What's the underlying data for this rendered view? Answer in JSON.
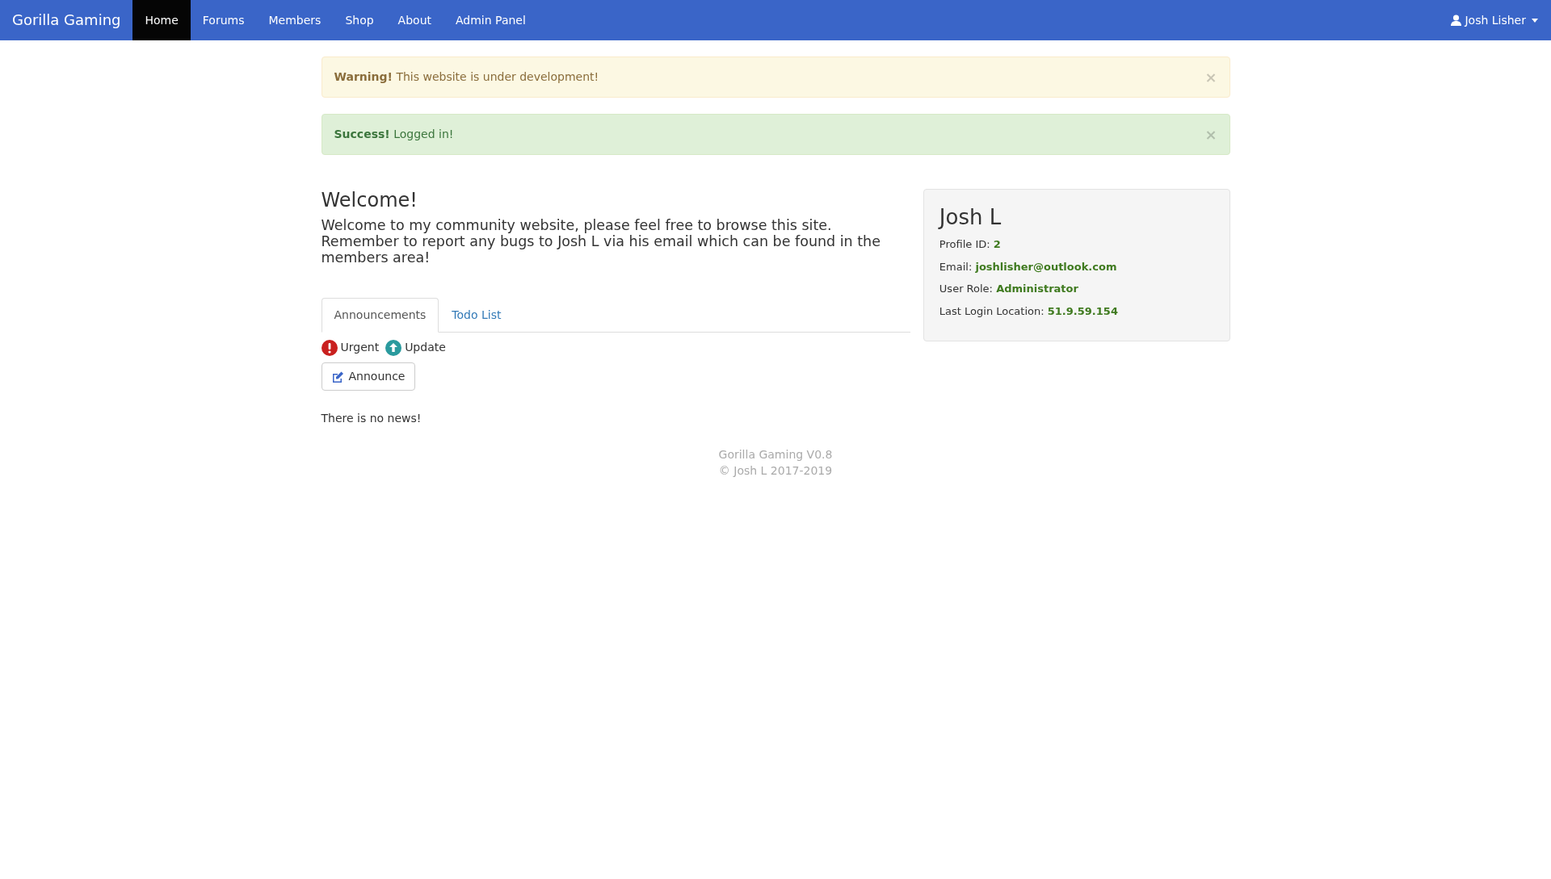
{
  "navbar": {
    "brand": "Gorilla Gaming",
    "items": [
      {
        "label": "Home",
        "selected": true
      },
      {
        "label": "Forums",
        "selected": false
      },
      {
        "label": "Members",
        "selected": false
      },
      {
        "label": "Shop",
        "selected": false
      },
      {
        "label": "About",
        "selected": false
      },
      {
        "label": "Admin Panel",
        "selected": false
      }
    ],
    "user": {
      "label": "Josh Lisher"
    }
  },
  "alerts": [
    {
      "kind": "warning",
      "text": "**Warning!** This website is under development!",
      "close": "×"
    },
    {
      "kind": "success",
      "text": "**Success!** Logged in!",
      "close": "×"
    }
  ],
  "welcome": {
    "title": "Welcome!",
    "text": "Welcome to my community website, please feel free to browse this site. Remember to report any bugs to Josh L via his email which can be found in the members area!"
  },
  "tabs": [
    {
      "label": "Announcements",
      "selected": true
    },
    {
      "label": "Todo List",
      "selected": false
    }
  ],
  "legend": [
    {
      "kind": "urgent",
      "label": "Urgent"
    },
    {
      "kind": "update",
      "label": "Update"
    }
  ],
  "announce_button": "Announce",
  "news_text": "There is no news!",
  "profile": {
    "name": "Josh L",
    "fields": [
      {
        "label": "Profile ID:",
        "value": "2"
      },
      {
        "label": "Email:",
        "value": "joshlisher@outlook.com"
      },
      {
        "label": "User Role:",
        "value": "Administrator"
      },
      {
        "label": "Last Login Location:",
        "value": "51.9.59.154"
      }
    ]
  },
  "footer": {
    "lines": [
      "Gorilla Gaming V0.8",
      "© Josh L 2017-2019"
    ]
  }
}
